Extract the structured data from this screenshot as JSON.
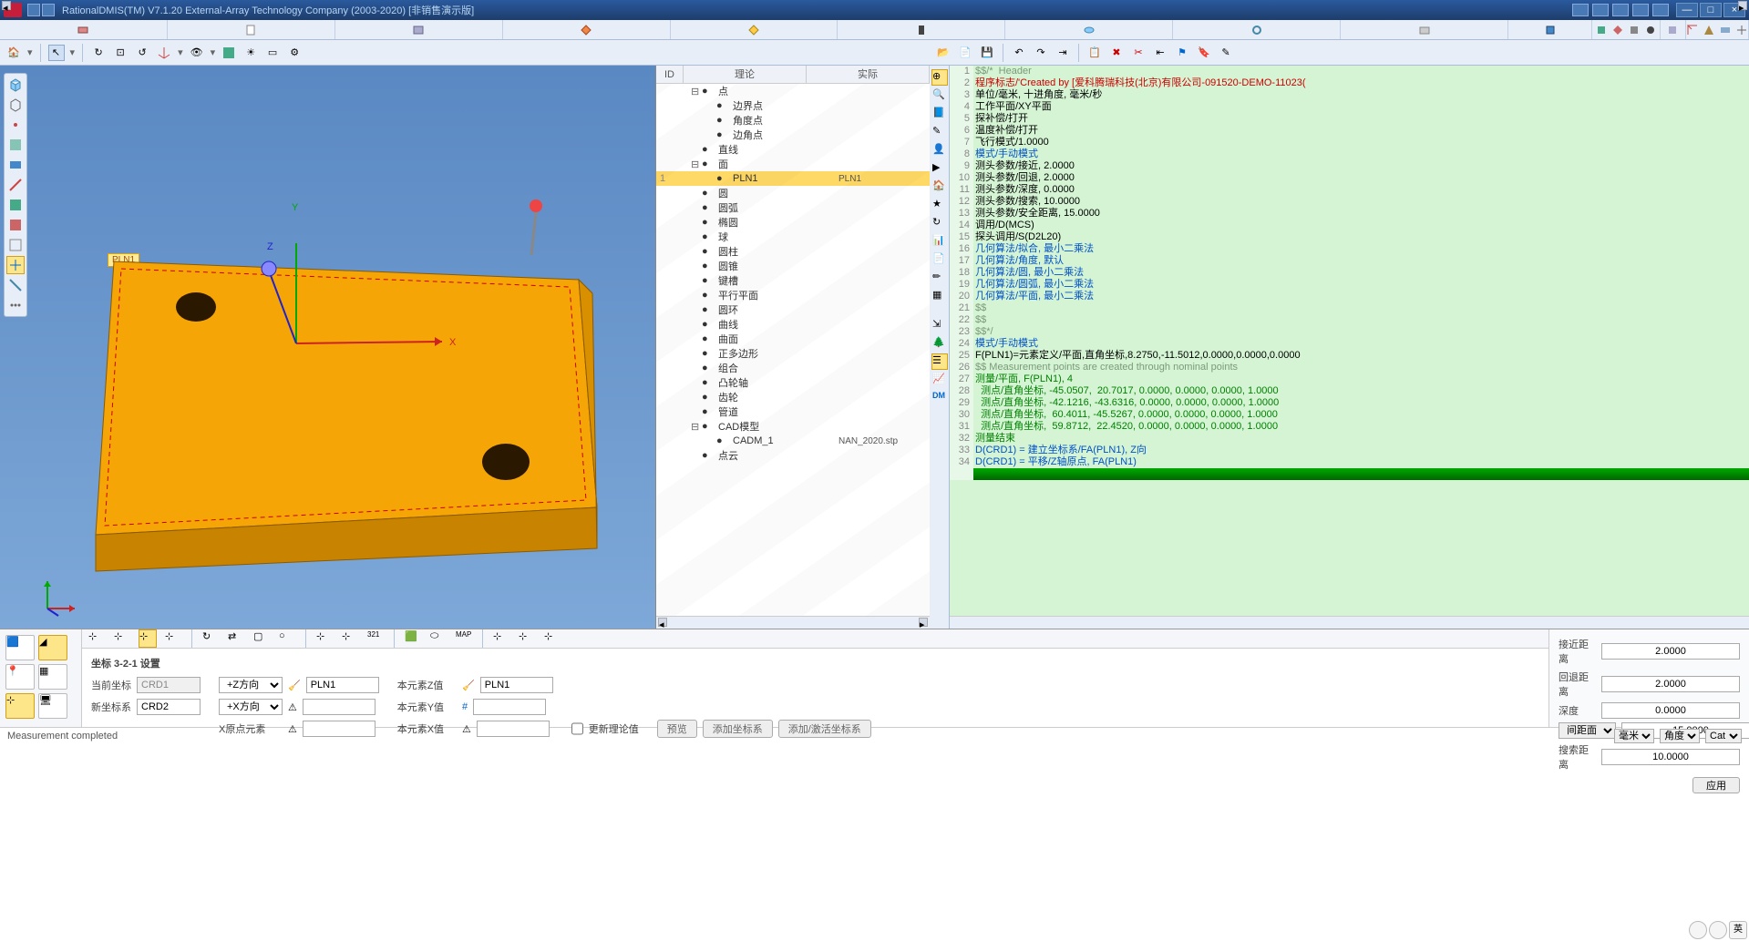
{
  "app": {
    "title": "RationalDMIS(TM) V7.1.20    External-Array Technology Company (2003-2020) [非销售演示版]"
  },
  "tree": {
    "hdr": {
      "id": "ID",
      "nom": "理论",
      "act": "实际"
    },
    "items": [
      {
        "exp": "⊟",
        "lbl": "点"
      },
      {
        "ind": 1,
        "lbl": "边界点"
      },
      {
        "ind": 1,
        "lbl": "角度点"
      },
      {
        "ind": 1,
        "lbl": "边角点"
      },
      {
        "exp": "",
        "lbl": "直线"
      },
      {
        "exp": "⊟",
        "lbl": "面"
      },
      {
        "num": "1",
        "ind": 1,
        "lbl": "PLN1",
        "val": "PLN1",
        "sel": true
      },
      {
        "lbl": "圆"
      },
      {
        "lbl": "圆弧"
      },
      {
        "lbl": "椭圆"
      },
      {
        "lbl": "球"
      },
      {
        "lbl": "圆柱"
      },
      {
        "lbl": "圆锥"
      },
      {
        "lbl": "键槽"
      },
      {
        "lbl": "平行平面"
      },
      {
        "lbl": "圆环"
      },
      {
        "lbl": "曲线"
      },
      {
        "lbl": "曲面"
      },
      {
        "lbl": "正多边形"
      },
      {
        "lbl": "组合"
      },
      {
        "lbl": "凸轮轴"
      },
      {
        "lbl": "齿轮"
      },
      {
        "lbl": "管道"
      },
      {
        "exp": "⊟",
        "lbl": "CAD模型",
        "cad": true
      },
      {
        "ind": 1,
        "lbl": "CADM_1",
        "val": "NAN_2020.stp"
      },
      {
        "lbl": "点云"
      }
    ]
  },
  "viewport": {
    "label": "PLN1",
    "axes": {
      "x": "X",
      "y": "Y",
      "z": "Z"
    }
  },
  "code": [
    {
      "n": 1,
      "cls": "c-gray",
      "t": "$$/*  Header"
    },
    {
      "n": 2,
      "cls": "c-red",
      "t": "程序标志/'Created by [爱科腾瑞科技(北京)有限公司-091520-DEMO-11023("
    },
    {
      "n": 3,
      "cls": "c-black",
      "t": "单位/毫米, 十进角度, 毫米/秒"
    },
    {
      "n": 4,
      "cls": "c-black",
      "t": "工作平面/XY平面"
    },
    {
      "n": 5,
      "cls": "c-black",
      "t": "探补偿/打开"
    },
    {
      "n": 6,
      "cls": "c-black",
      "t": "温度补偿/打开"
    },
    {
      "n": 7,
      "cls": "c-black",
      "t": "飞行模式/1.0000"
    },
    {
      "n": 8,
      "cls": "c-blue",
      "t": "模式/手动模式"
    },
    {
      "n": 9,
      "cls": "c-black",
      "t": "测头参数/接近, 2.0000"
    },
    {
      "n": 10,
      "cls": "c-black",
      "t": "测头参数/回退, 2.0000"
    },
    {
      "n": 11,
      "cls": "c-black",
      "t": "测头参数/深度, 0.0000"
    },
    {
      "n": 12,
      "cls": "c-black",
      "t": "测头参数/搜索, 10.0000"
    },
    {
      "n": 13,
      "cls": "c-black",
      "t": "测头参数/安全距离, 15.0000"
    },
    {
      "n": 14,
      "cls": "c-black",
      "t": "调用/D(MCS)"
    },
    {
      "n": 15,
      "cls": "c-black",
      "t": "探头调用/S(D2L20)"
    },
    {
      "n": 16,
      "cls": "c-blue",
      "t": "几何算法/拟合, 最小二乘法"
    },
    {
      "n": 17,
      "cls": "c-blue",
      "t": "几何算法/角度, 默认"
    },
    {
      "n": 18,
      "cls": "c-blue",
      "t": "几何算法/圆, 最小二乘法"
    },
    {
      "n": 19,
      "cls": "c-blue",
      "t": "几何算法/圆弧, 最小二乘法"
    },
    {
      "n": 20,
      "cls": "c-blue",
      "t": "几何算法/平面, 最小二乘法"
    },
    {
      "n": 21,
      "cls": "c-gray",
      "t": "$$"
    },
    {
      "n": 22,
      "cls": "c-gray",
      "t": "$$"
    },
    {
      "n": 23,
      "cls": "c-gray",
      "t": "$$*/"
    },
    {
      "n": 24,
      "cls": "c-blue",
      "t": "模式/手动模式"
    },
    {
      "n": 25,
      "cls": "c-black",
      "t": "F(PLN1)=元素定义/平面,直角坐标,8.2750,-11.5012,0.0000,0.0000,0.0000"
    },
    {
      "n": 26,
      "cls": "c-gray",
      "t": "$$ Measurement points are created through nominal points"
    },
    {
      "n": 27,
      "cls": "c-green",
      "t": "测量/平面, F(PLN1), 4"
    },
    {
      "n": 28,
      "cls": "c-green",
      "t": "  测点/直角坐标, -45.0507,  20.7017, 0.0000, 0.0000, 0.0000, 1.0000"
    },
    {
      "n": 29,
      "cls": "c-green",
      "t": "  测点/直角坐标, -42.1216, -43.6316, 0.0000, 0.0000, 0.0000, 1.0000"
    },
    {
      "n": 30,
      "cls": "c-green",
      "t": "  测点/直角坐标,  60.4011, -45.5267, 0.0000, 0.0000, 0.0000, 1.0000"
    },
    {
      "n": 31,
      "cls": "c-green",
      "t": "  测点/直角坐标,  59.8712,  22.4520, 0.0000, 0.0000, 0.0000, 1.0000"
    },
    {
      "n": 32,
      "cls": "c-green",
      "t": "测量结束"
    },
    {
      "n": 33,
      "cls": "c-blue",
      "t": "D(CRD1) = 建立坐标系/FA(PLN1), Z向"
    },
    {
      "n": 34,
      "cls": "c-blue",
      "t": "D(CRD1) = 平移/Z轴原点, FA(PLN1)"
    }
  ],
  "bottom": {
    "title": "坐标 3-2-1 设置",
    "cur": "当前坐标",
    "curv": "CRD1",
    "new": "新坐标系",
    "newv": "CRD2",
    "zdir": "+Z方向",
    "xdir": "+X方向",
    "xorig": "X原点元素",
    "pln": "PLN1",
    "bz": "本元素Z值",
    "by": "本元素Y值",
    "bx": "本元素X值",
    "pln2": "PLN1",
    "chk": "更新理论值",
    "btn1": "预览",
    "btn2": "添加坐标系",
    "btn3": "添加/激活坐标系"
  },
  "right": {
    "l1": "接近距离",
    "v1": "2.0000",
    "l2": "回退距离",
    "v2": "2.0000",
    "l3": "深度",
    "v3": "0.0000",
    "l4": "间距面",
    "v4": "15.0000",
    "l5": "搜索距离",
    "v5": "10.0000",
    "apply": "应用"
  },
  "status": {
    "msg": "Measurement completed",
    "u1": "毫米",
    "u2": "角度",
    "u3": "Cat",
    "u4": "英"
  }
}
